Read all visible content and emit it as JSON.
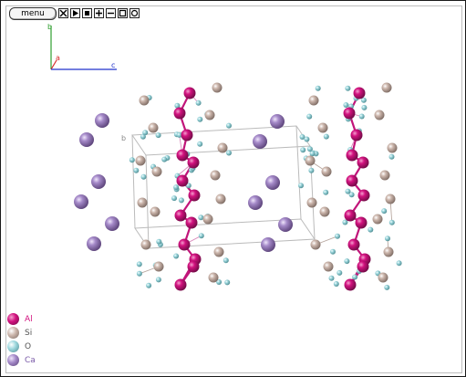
{
  "toolbar": {
    "menu_label": "menu",
    "buttons": [
      "close-icon",
      "play-icon",
      "stop-icon",
      "plus-icon",
      "minus-icon",
      "square-icon",
      "circle-icon"
    ]
  },
  "axes": {
    "a": "a",
    "b": "b",
    "c": "c",
    "colors": {
      "a": "#d62828",
      "b": "#2f9e2f",
      "c": "#2233cc"
    }
  },
  "cell_label": "b",
  "legend": [
    {
      "symbol": "Al",
      "color": "#d2127f"
    },
    {
      "symbol": "Si",
      "color": "#c9b2a8"
    },
    {
      "symbol": "O",
      "color": "#8fd0d6"
    },
    {
      "symbol": "Ca",
      "color": "#a58ac9"
    }
  ]
}
